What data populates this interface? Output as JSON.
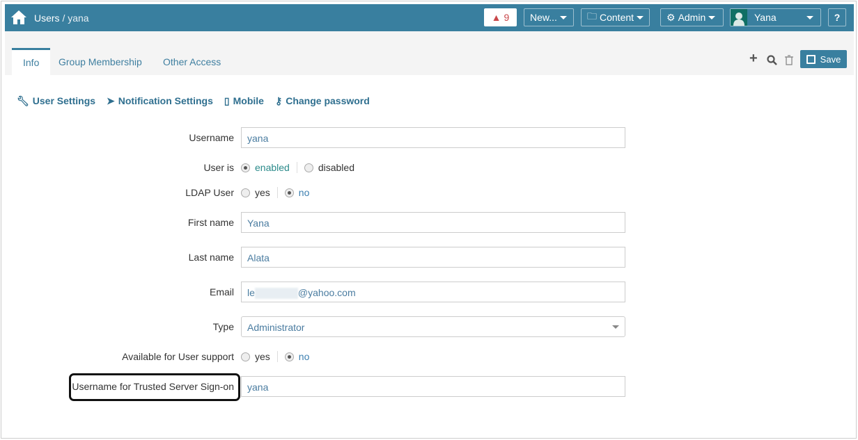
{
  "header": {
    "breadcrumb_root": "Users",
    "breadcrumb_sep": " / ",
    "breadcrumb_current": "yana",
    "alert_count": "9",
    "new_label": "New...",
    "content_label": "Content",
    "admin_label": "Admin",
    "user_name": "Yana",
    "help_label": "?"
  },
  "tabs": [
    {
      "label": "Info"
    },
    {
      "label": "Group Membership"
    },
    {
      "label": "Other Access"
    }
  ],
  "toolbar": {
    "save_label": "Save"
  },
  "sublinks": [
    {
      "label": "User Settings"
    },
    {
      "label": "Notification Settings"
    },
    {
      "label": "Mobile"
    },
    {
      "label": "Change password"
    }
  ],
  "form": {
    "username": {
      "label": "Username",
      "value": "yana"
    },
    "user_is": {
      "label": "User is",
      "options": [
        "enabled",
        "disabled"
      ],
      "selected": "enabled"
    },
    "ldap": {
      "label": "LDAP User",
      "options": [
        "yes",
        "no"
      ],
      "selected": "no"
    },
    "first_name": {
      "label": "First name",
      "value": "Yana"
    },
    "last_name": {
      "label": "Last name",
      "value": "Alata"
    },
    "email": {
      "label": "Email",
      "value_prefix": "le",
      "value_suffix": "@yahoo.com"
    },
    "type": {
      "label": "Type",
      "value": "Administrator"
    },
    "support": {
      "label": "Available for User support",
      "options": [
        "yes",
        "no"
      ],
      "selected": "no"
    },
    "trusted": {
      "label": "Username for Trusted Server Sign-on",
      "value": "yana"
    }
  },
  "colors": {
    "brand": "#397f9f",
    "alert": "#c9474a"
  }
}
